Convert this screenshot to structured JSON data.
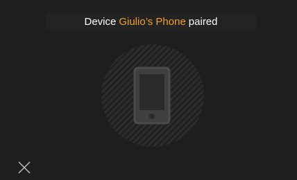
{
  "notification": {
    "prefix": "Device",
    "device_name": "Giulio’s Phone",
    "suffix": "paired"
  },
  "icons": {
    "device": "smartphone-icon",
    "close": "close-icon"
  },
  "colors": {
    "background": "#1e1e1e",
    "accent": "#f0a030",
    "text": "#ffffff",
    "icon": "#4a4a4a"
  }
}
